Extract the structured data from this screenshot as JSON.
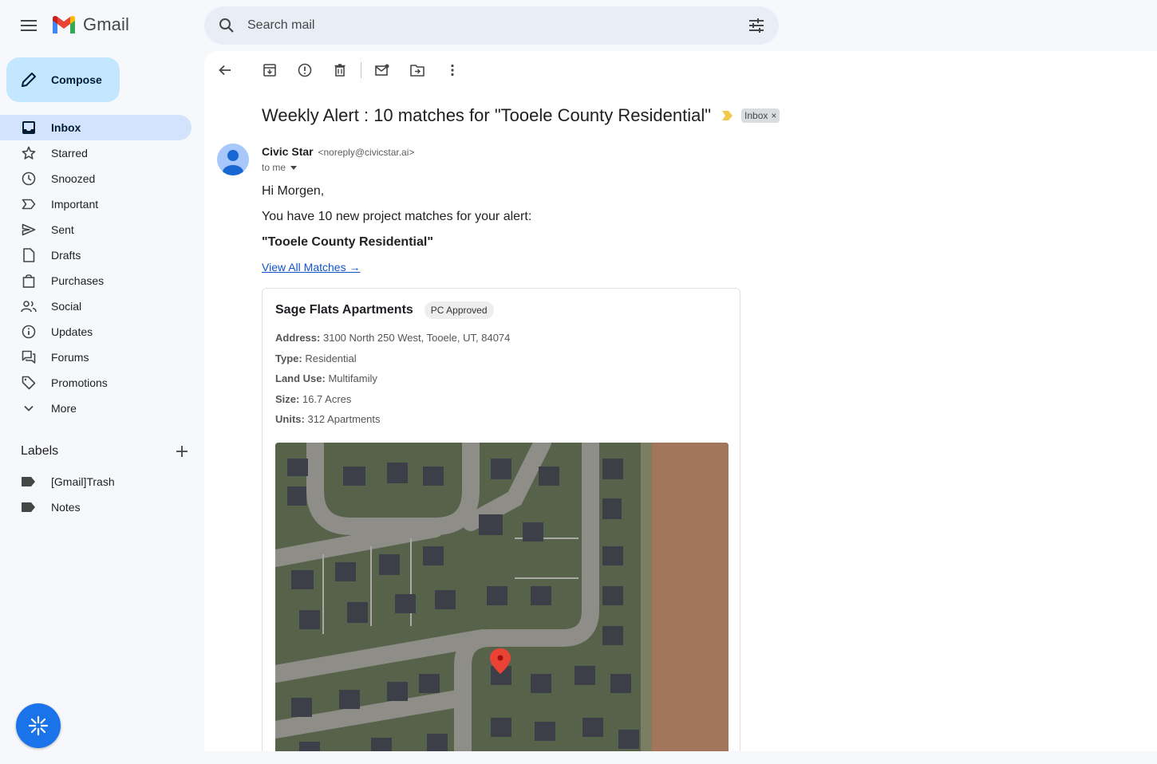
{
  "app": {
    "name": "Gmail"
  },
  "search": {
    "placeholder": "Search mail"
  },
  "compose": {
    "label": "Compose"
  },
  "nav": {
    "items": [
      {
        "label": "Inbox",
        "icon": "inbox-icon",
        "active": true
      },
      {
        "label": "Starred",
        "icon": "star-icon"
      },
      {
        "label": "Snoozed",
        "icon": "clock-icon"
      },
      {
        "label": "Important",
        "icon": "important-icon"
      },
      {
        "label": "Sent",
        "icon": "send-icon"
      },
      {
        "label": "Drafts",
        "icon": "draft-icon"
      },
      {
        "label": "Purchases",
        "icon": "shopping-bag-icon"
      },
      {
        "label": "Social",
        "icon": "people-icon"
      },
      {
        "label": "Updates",
        "icon": "info-icon"
      },
      {
        "label": "Forums",
        "icon": "forum-icon"
      },
      {
        "label": "Promotions",
        "icon": "tag-icon"
      },
      {
        "label": "More",
        "icon": "chevron-down-icon"
      }
    ]
  },
  "labels": {
    "heading": "Labels",
    "items": [
      {
        "label": "[Gmail]Trash",
        "icon": "label-icon"
      },
      {
        "label": "Notes",
        "icon": "label-icon"
      }
    ]
  },
  "email": {
    "subject": "Weekly Alert : 10 matches for \"Tooele County Residential\"",
    "chip": "Inbox",
    "chip_close": "×",
    "sender_name": "Civic Star",
    "sender_email": "<noreply@civicstar.ai>",
    "to": "to me",
    "greeting": "Hi Morgen,",
    "intro": "You have 10 new project matches for your alert:",
    "alert_name": "\"Tooele County Residential\"",
    "view_all": "View All Matches →",
    "project": {
      "title": "Sage Flats Apartments",
      "status": "PC Approved",
      "address_label": "Address:",
      "address": "3100 North 250 West, Tooele, UT, 84074",
      "type_label": "Type:",
      "type": "Residential",
      "land_use_label": "Land Use:",
      "land_use": "Multifamily",
      "size_label": "Size:",
      "size": "16.7 Acres",
      "units_label": "Units:",
      "units": "312 Apartments"
    }
  },
  "colors": {
    "accent": "#1a73e8",
    "compose_bg": "#c2e7ff",
    "active_nav": "#d3e3fd",
    "important_marker": "#f2c94c",
    "map_pin": "#ea4335"
  }
}
